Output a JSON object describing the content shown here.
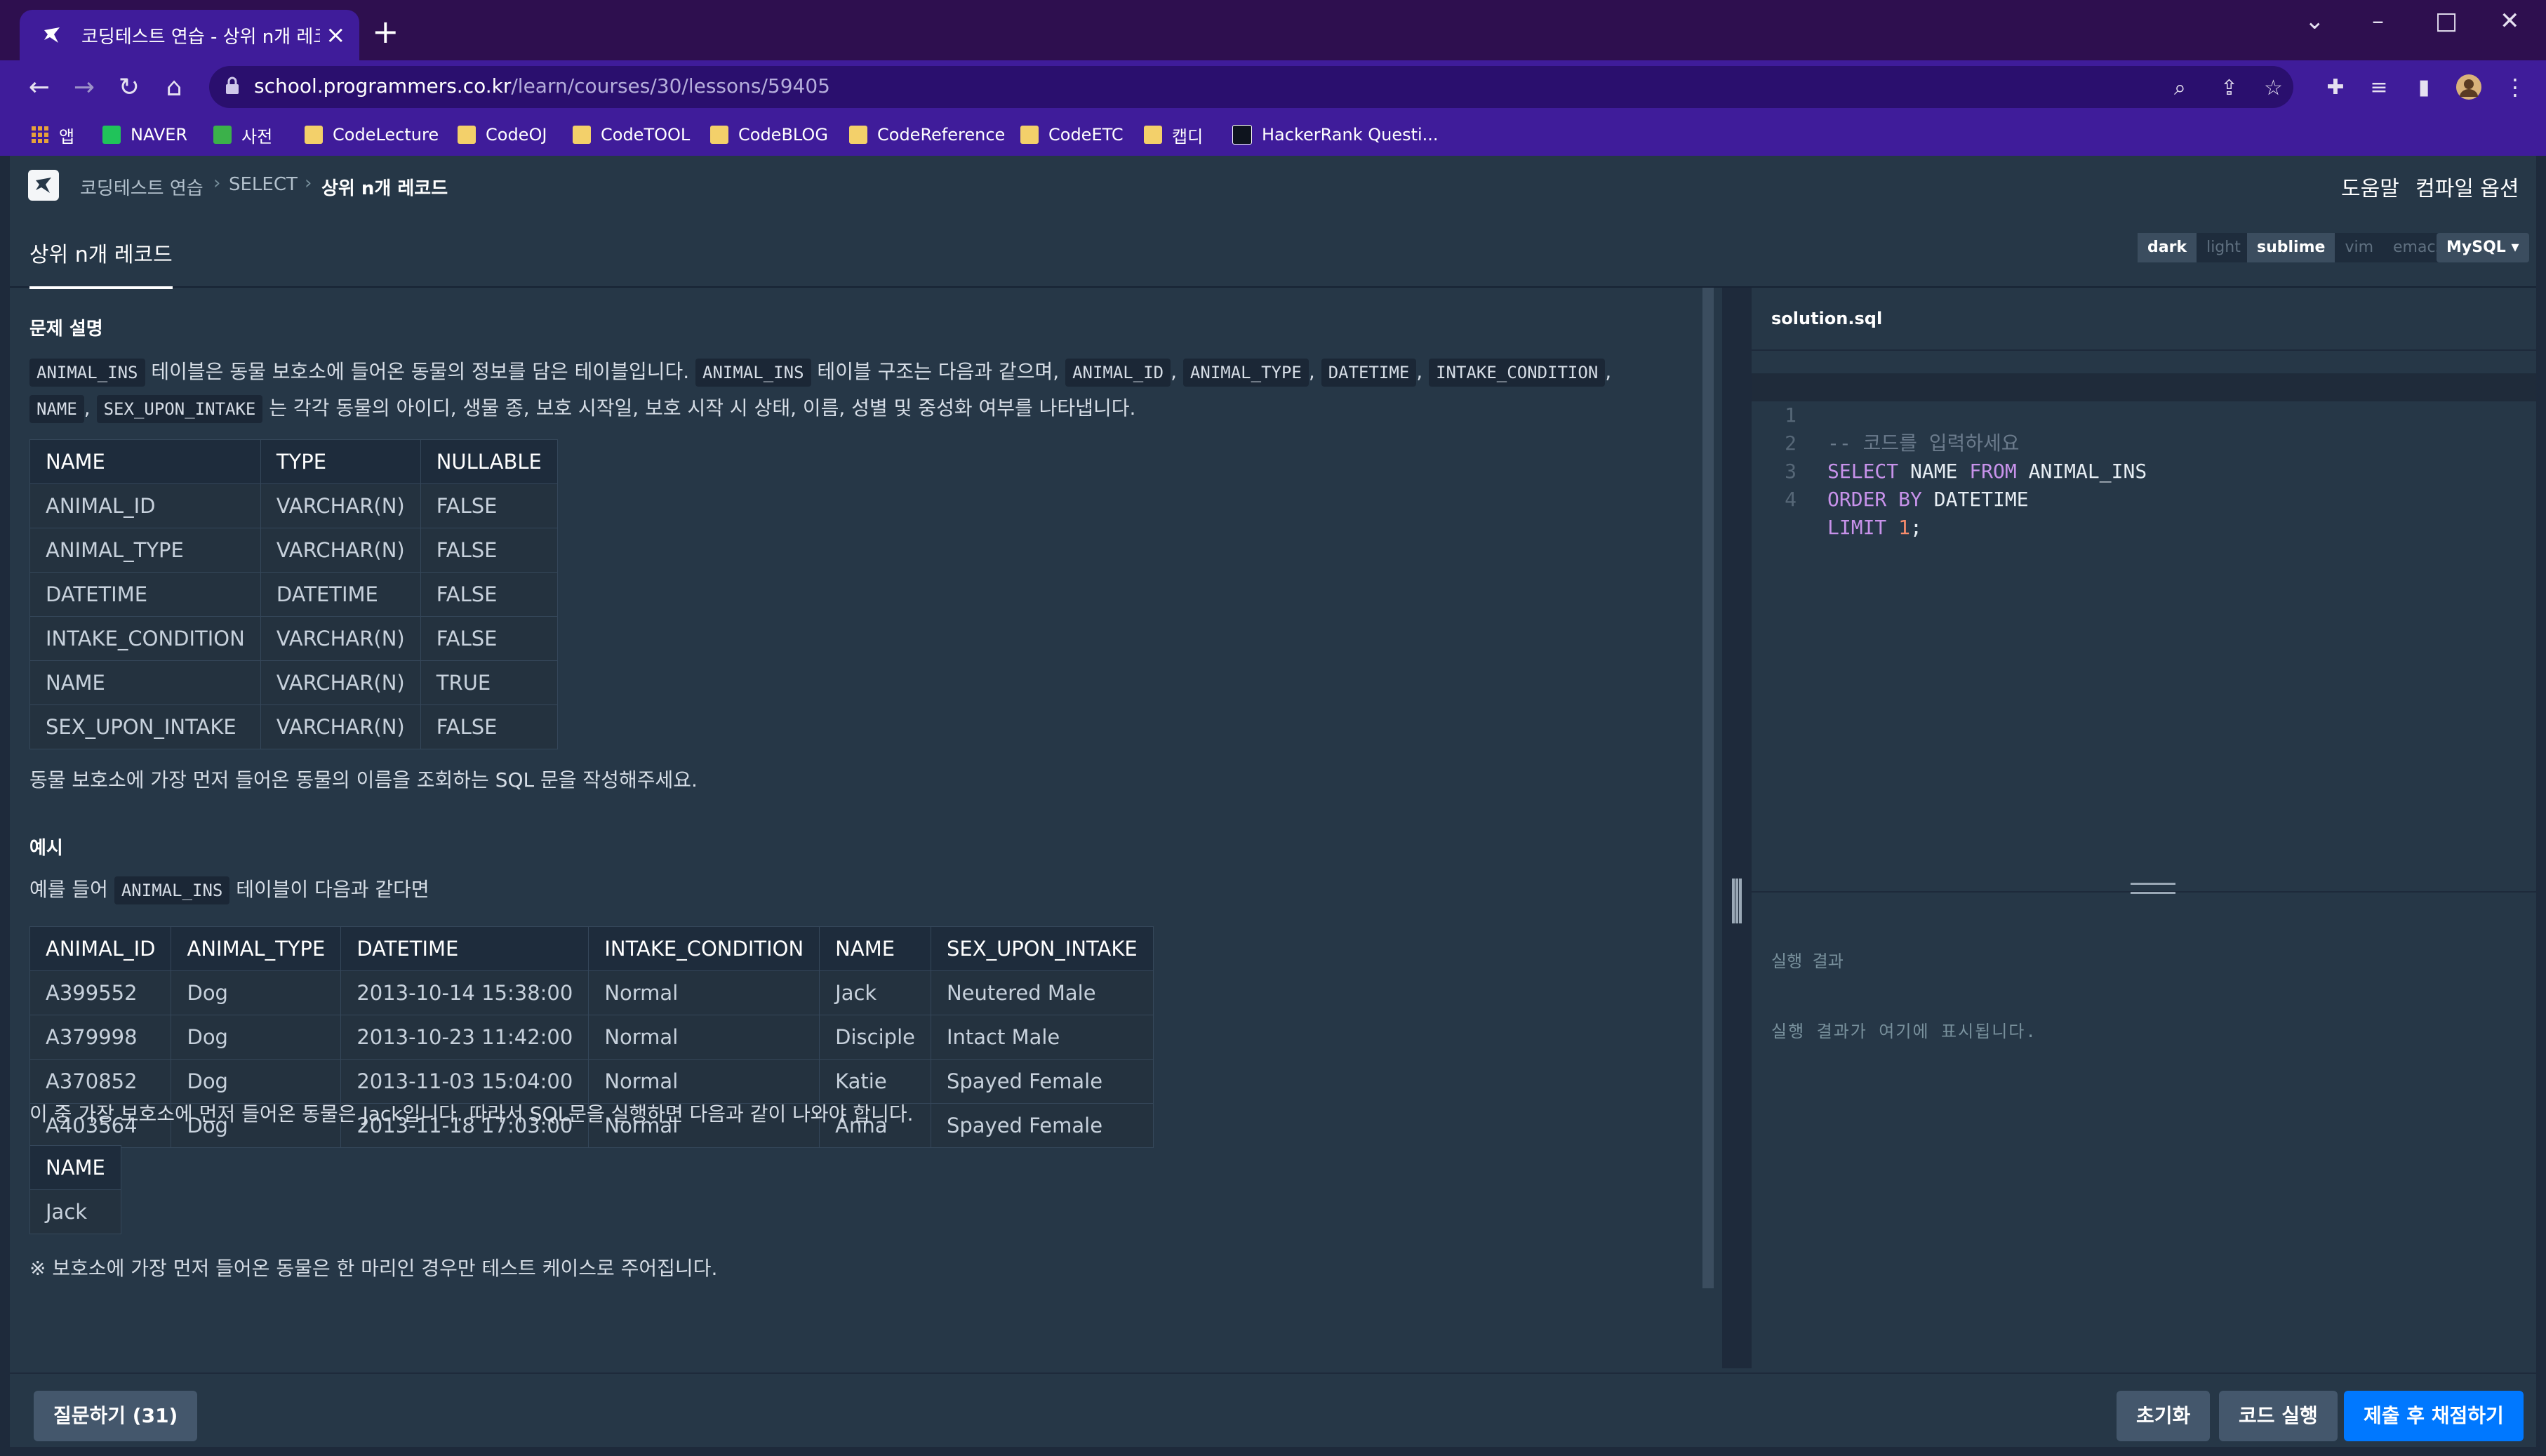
{
  "browser": {
    "tab_title": "코딩테스트 연습 - 상위 n개 레코",
    "url_host": "school.programmers.co.kr",
    "url_path": "/learn/courses/30/lessons/59405",
    "bookmarks": [
      "앱",
      "NAVER",
      "사전",
      "CodeLecture",
      "CodeOJ",
      "CodeTOOL",
      "CodeBLOG",
      "CodeReference",
      "CodeETC",
      "캡디",
      "HackerRank Questi..."
    ]
  },
  "header": {
    "breadcrumb": [
      "코딩테스트 연습",
      "SELECT",
      "상위 n개 레코드"
    ],
    "help": "도움말",
    "compile_options": "컴파일 옵션"
  },
  "lesson": {
    "tab_title": "상위 n개 레코드"
  },
  "editor_options": {
    "themes": [
      "dark",
      "light"
    ],
    "keymaps": [
      "sublime",
      "vim",
      "emacs"
    ],
    "language": "MySQL"
  },
  "problem": {
    "section_title": "문제 설명",
    "intro_parts": [
      "ANIMAL_INS",
      " 테이블은 동물 보호소에 들어온 동물의 정보를 담은 테이블입니다. ",
      "ANIMAL_INS",
      " 테이블 구조는 다음과 같으며, ",
      "ANIMAL_ID",
      ", ",
      "ANIMAL_TYPE",
      ", ",
      "DATETIME",
      ", ",
      "INTAKE_CONDITION",
      ","
    ],
    "intro_parts2": [
      "NAME",
      ", ",
      "SEX_UPON_INTAKE",
      " 는 각각 동물의 아이디, 생물 종, 보호 시작일, 보호 시작 시 상태, 이름, 성별 및 중성화 여부를 나타냅니다."
    ],
    "schema_headers": [
      "NAME",
      "TYPE",
      "NULLABLE"
    ],
    "schema_rows": [
      [
        "ANIMAL_ID",
        "VARCHAR(N)",
        "FALSE"
      ],
      [
        "ANIMAL_TYPE",
        "VARCHAR(N)",
        "FALSE"
      ],
      [
        "DATETIME",
        "DATETIME",
        "FALSE"
      ],
      [
        "INTAKE_CONDITION",
        "VARCHAR(N)",
        "FALSE"
      ],
      [
        "NAME",
        "VARCHAR(N)",
        "TRUE"
      ],
      [
        "SEX_UPON_INTAKE",
        "VARCHAR(N)",
        "FALSE"
      ]
    ],
    "task": "동물 보호소에 가장 먼저 들어온 동물의 이름을 조회하는 SQL 문을 작성해주세요.",
    "example_title": "예시",
    "example_intro_before": "예를 들어 ",
    "example_intro_code": "ANIMAL_INS",
    "example_intro_after": " 테이블이 다음과 같다면",
    "example_headers": [
      "ANIMAL_ID",
      "ANIMAL_TYPE",
      "DATETIME",
      "INTAKE_CONDITION",
      "NAME",
      "SEX_UPON_INTAKE"
    ],
    "example_rows": [
      [
        "A399552",
        "Dog",
        "2013-10-14 15:38:00",
        "Normal",
        "Jack",
        "Neutered Male"
      ],
      [
        "A379998",
        "Dog",
        "2013-10-23 11:42:00",
        "Normal",
        "Disciple",
        "Intact Male"
      ],
      [
        "A370852",
        "Dog",
        "2013-11-03 15:04:00",
        "Normal",
        "Katie",
        "Spayed Female"
      ],
      [
        "A403564",
        "Dog",
        "2013-11-18 17:03:00",
        "Normal",
        "Anna",
        "Spayed Female"
      ]
    ],
    "example_result_text": "이 중 가장 보호소에 먼저 들어온 동물은 Jack입니다. 따라서 SQL문을 실행하면 다음과 같이 나와야 합니다.",
    "result_headers": [
      "NAME"
    ],
    "result_rows": [
      [
        "Jack"
      ]
    ],
    "note": "※ 보호소에 가장 먼저 들어온 동물은 한 마리인 경우만 테스트 케이스로 주어집니다."
  },
  "editor": {
    "filename": "solution.sql",
    "line_numbers": [
      "1",
      "2",
      "3",
      "4"
    ],
    "comment": "-- 코드를 입력하세요",
    "line2": [
      "SELECT",
      " NAME ",
      "FROM",
      " ANIMAL_INS"
    ],
    "line3": [
      "ORDER BY",
      " DATETIME"
    ],
    "line4": [
      "LIMIT",
      " ",
      "1",
      ";"
    ]
  },
  "result": {
    "label": "실행 결과",
    "placeholder": "실행 결과가 여기에 표시됩니다."
  },
  "footer": {
    "question_button": "질문하기 (31)",
    "reset_button": "초기화",
    "run_button": "코드 실행",
    "submit_button": "제출 후 채점하기"
  }
}
